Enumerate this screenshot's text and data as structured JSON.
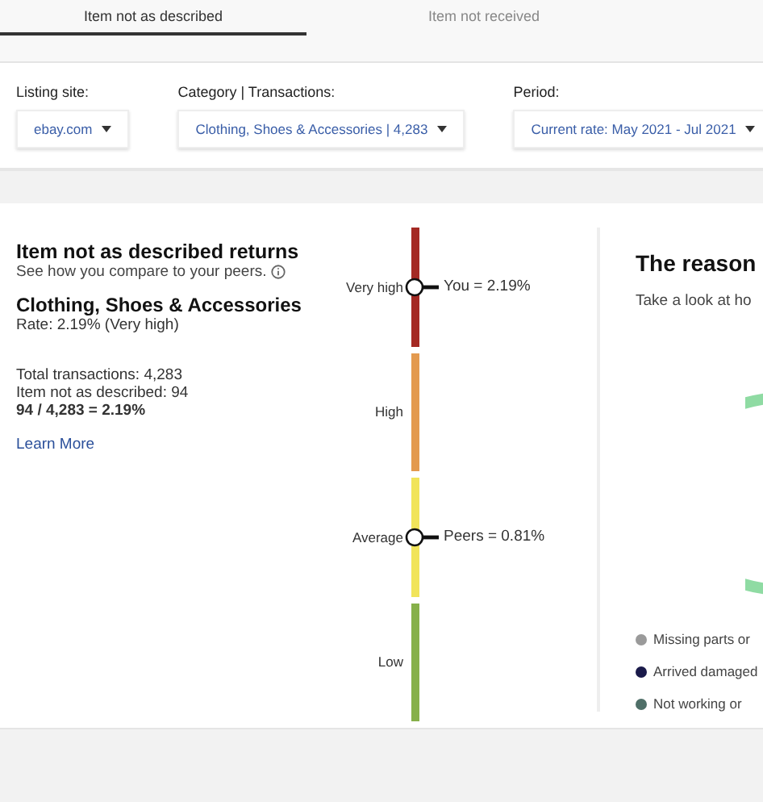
{
  "tabs": [
    {
      "label": "Item not as described",
      "selected": true
    },
    {
      "label": "Item not received",
      "selected": false
    }
  ],
  "filters": [
    {
      "label": "Listing site:",
      "value": "ebay.com"
    },
    {
      "label": "Category | Transactions:",
      "value": "Clothing, Shoes & Accessories | 4,283"
    },
    {
      "label": "Period:",
      "value": "Current rate: May 2021 - Jul 2021"
    }
  ],
  "summary": {
    "title": "Item not as described returns",
    "subtitle": "See how you compare to your peers.",
    "category": "Clothing, Shoes & Accessories",
    "rate": "Rate: 2.19% (Very high)",
    "stats": [
      "Total transactions: 4,283",
      "Item not as described: 94"
    ],
    "formula": "94 / 4,283 = 2.19%",
    "link": "Learn More"
  },
  "meter": {
    "bands": [
      {
        "label": "Very high",
        "color": "#a42a24",
        "marker": "You = 2.19%"
      },
      {
        "label": "High",
        "color": "#e39a4f"
      },
      {
        "label": "Average",
        "color": "#f1e45a",
        "marker": "Peers = 0.81%"
      },
      {
        "label": "Low",
        "color": "#86b04a"
      }
    ]
  },
  "reasons": {
    "title": "The reason",
    "subtitle": "Take a look at ho",
    "legend": [
      {
        "label": "Missing parts or",
        "color": "#9a9a9a"
      },
      {
        "label": "Arrived damaged",
        "color": "#1a1a4a"
      },
      {
        "label": "Not working or",
        "color": "#4f6f68"
      }
    ]
  }
}
